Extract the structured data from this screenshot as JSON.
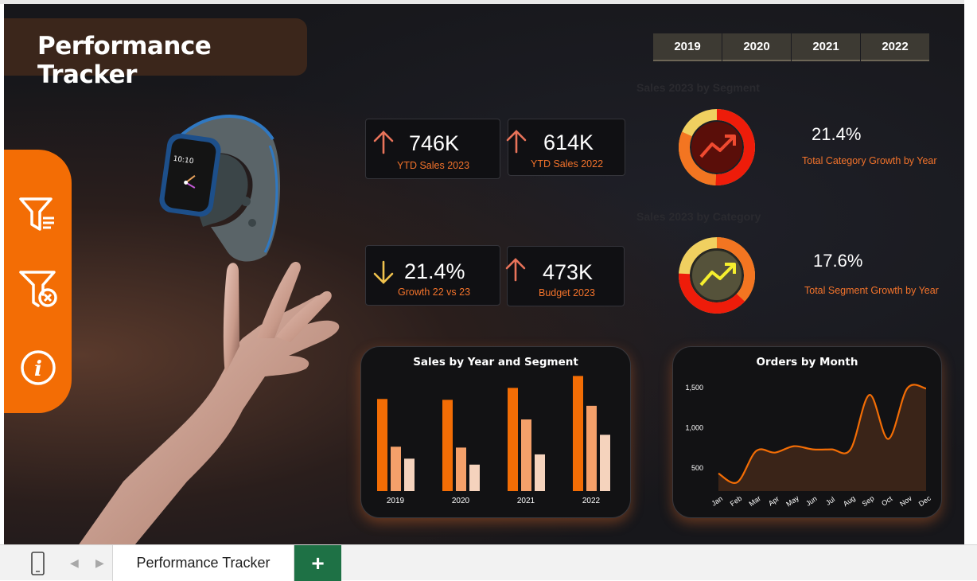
{
  "title": "Performance Tracker",
  "years": [
    "2019",
    "2020",
    "2021",
    "2022"
  ],
  "ghost_labels": {
    "segment": "Sales 2023 by Segment",
    "category": "Sales 2023 by Category"
  },
  "kpis": {
    "ytd_2023": {
      "value": "746K",
      "label": "YTD Sales 2023",
      "trend": "up"
    },
    "ytd_2022": {
      "value": "614K",
      "label": "YTD Sales 2022",
      "trend": "up"
    },
    "growth": {
      "value": "21.4%",
      "label": "Growth 22 vs 23",
      "trend": "down"
    },
    "budget": {
      "value": "473K",
      "label": "Budget 2023",
      "trend": "up"
    }
  },
  "donuts": {
    "category_growth": {
      "value": "21.4%",
      "label": "Total Category Growth by Year"
    },
    "segment_growth": {
      "value": "17.6%",
      "label": "Total Segment Growth by Year"
    }
  },
  "side_icons": [
    "filter-list-icon",
    "clear-filter-icon",
    "info-icon"
  ],
  "colors": {
    "accent": "#f36d05",
    "label_orange": "#f3732b",
    "bar_dark": "#f36d05",
    "bar_mid": "#f4a06a",
    "bar_light": "#f5d3bd",
    "arrow_up": "#e8735a",
    "arrow_down": "#f0c24d",
    "sheet_add": "#1e7145"
  },
  "tabs": {
    "sheet_name": "Performance Tracker",
    "add_symbol": "+",
    "prev_symbol": "◀",
    "next_symbol": "▶"
  },
  "chart_data": [
    {
      "type": "bar",
      "title": "Sales by Year and Segment",
      "categories": [
        "2019",
        "2020",
        "2021",
        "2022"
      ],
      "series": [
        {
          "values": [
            108,
            107,
            121,
            135
          ]
        },
        {
          "values": [
            52,
            51,
            84,
            100
          ]
        },
        {
          "values": [
            38,
            31,
            43,
            66
          ]
        }
      ],
      "ylim": [
        0,
        140
      ],
      "grid": false
    },
    {
      "type": "area",
      "title": "Orders by Month",
      "categories": [
        "Jan",
        "Feb",
        "Mar",
        "Apr",
        "May",
        "Jun",
        "Jul",
        "Aug",
        "Sep",
        "Oct",
        "Nov",
        "Dec"
      ],
      "values": [
        420,
        310,
        700,
        680,
        760,
        720,
        720,
        720,
        1400,
        850,
        1480,
        1480
      ],
      "yticks": [
        "500",
        "1,000",
        "1,500"
      ],
      "ytick_values": [
        500,
        1000,
        1500
      ],
      "ylim": [
        200,
        1600
      ],
      "grid": false
    }
  ]
}
